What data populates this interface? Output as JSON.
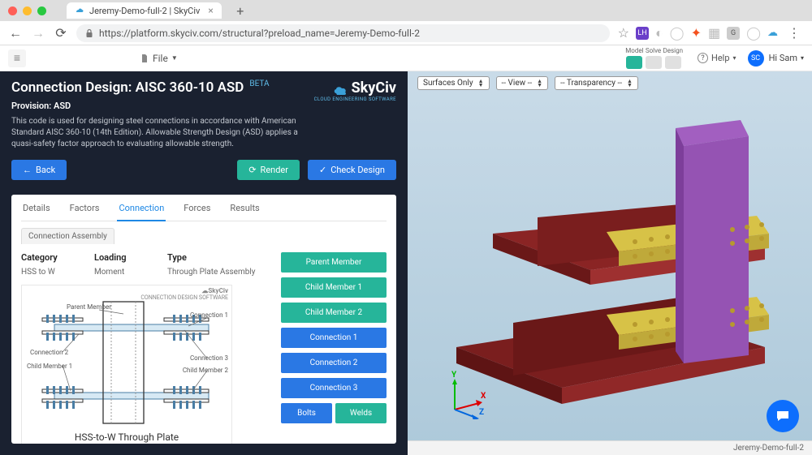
{
  "browser": {
    "tab_title": "Jeremy-Demo-full-2 | SkyCiv",
    "url": "https://platform.skyciv.com/structural?preload_name=Jeremy-Demo-full-2"
  },
  "appstrip": {
    "file_label": "File",
    "modes": {
      "model": "Model",
      "solve": "Solve",
      "design": "Design"
    },
    "help_label": "Help",
    "user_initials": "SC",
    "greeting": "Hi Sam"
  },
  "header": {
    "title": "Connection Design: AISC 360-10 ASD",
    "beta": "BETA",
    "brand": "SkyCiv",
    "brand_tag": "CLOUD ENGINEERING SOFTWARE",
    "provision": "Provision: ASD",
    "description": "This code is used for designing steel connections in accordance with American Standard AISC 360-10 (14th Edition). Allowable Strength Design (ASD) applies a quasi-safety factor approach to evaluating allowable strength.",
    "back": "Back",
    "render": "Render",
    "check": "Check Design"
  },
  "tabs": {
    "items": [
      "Details",
      "Factors",
      "Connection",
      "Forces",
      "Results"
    ],
    "active_index": 2,
    "subtab": "Connection Assembly"
  },
  "props": {
    "category_h": "Category",
    "category_v": "HSS to W",
    "loading_h": "Loading",
    "loading_v": "Moment",
    "type_h": "Type",
    "type_v": "Through Plate Assembly"
  },
  "diagram": {
    "labels": {
      "parent": "Parent Member",
      "conn1": "Connection 1",
      "conn2": "Connection 2",
      "conn3": "Connection 3",
      "child1": "Child Member 1",
      "child2": "Child Member 2"
    },
    "title": "HSS-to-W Through Plate",
    "logo1": "SkyCiv",
    "logo2": "CONNECTION DESIGN SOFTWARE"
  },
  "sidebuttons": {
    "parent": "Parent Member",
    "child1": "Child Member 1",
    "child2": "Child Member 2",
    "conn1": "Connection 1",
    "conn2": "Connection 2",
    "conn3": "Connection 3",
    "bolts": "Bolts",
    "welds": "Welds"
  },
  "viewer": {
    "surfaces": "Surfaces Only",
    "view": "-- View --",
    "transparency": "-- Transparency --",
    "axes": {
      "x": "X",
      "y": "Y",
      "z": "Z"
    },
    "status": "Jeremy-Demo-full-2"
  }
}
